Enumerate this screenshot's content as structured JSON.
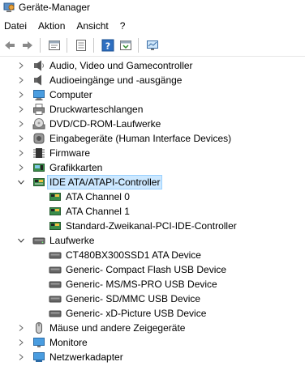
{
  "window": {
    "title": "Geräte-Manager"
  },
  "menu": {
    "items": [
      "Datei",
      "Aktion",
      "Ansicht",
      "?"
    ]
  },
  "toolbar": {
    "buttons": [
      "back-icon",
      "forward-icon",
      "properties-icon",
      "list-icon",
      "help-icon",
      "scan-icon",
      "monitor-icon"
    ]
  },
  "tree": {
    "audio": "Audio, Video und Gamecontroller",
    "audio_io": "Audioeingänge und -ausgänge",
    "computer": "Computer",
    "printqueues": "Druckwarteschlangen",
    "dvd": "DVD/CD-ROM-Laufwerke",
    "hid": "Eingabegeräte (Human Interface Devices)",
    "firmware": "Firmware",
    "graphics": "Grafikkarten",
    "ide": "IDE ATA/ATAPI-Controller",
    "ide_children": [
      "ATA Channel 0",
      "ATA Channel 1",
      "Standard-Zweikanal-PCI-IDE-Controller"
    ],
    "drives": "Laufwerke",
    "drive_children": [
      "CT480BX300SSD1 ATA Device",
      "Generic- Compact Flash USB Device",
      "Generic- MS/MS-PRO USB Device",
      "Generic- SD/MMC USB Device",
      "Generic- xD-Picture USB Device"
    ],
    "mice": "Mäuse und andere Zeigegeräte",
    "monitors": "Monitore",
    "network": "Netzwerkadapter"
  }
}
